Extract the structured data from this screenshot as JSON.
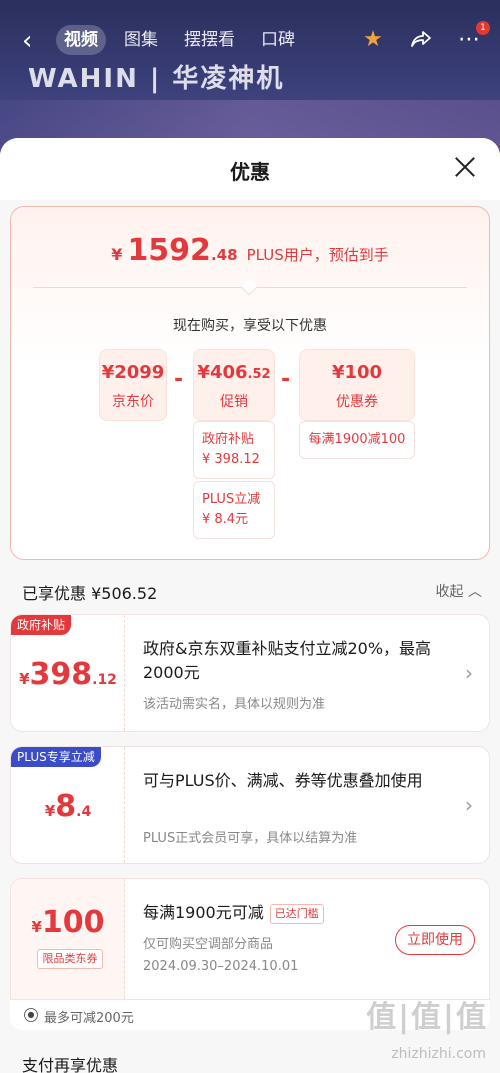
{
  "topbar": {
    "tabs": [
      "视频",
      "图集",
      "摆摆看",
      "口碑"
    ],
    "badge": "1"
  },
  "brand": "WAHIN | 华凌神机",
  "sheet": {
    "title": "优惠"
  },
  "summary": {
    "currency": "¥",
    "price_int": "1592",
    "price_dec": ".48",
    "price_note": "PLUS用户，预估到手",
    "now_text": "现在购买，享受以下优惠",
    "jd_price": {
      "amount": "¥2099",
      "label": "京东价"
    },
    "promo": {
      "amount": "¥406",
      "dec": ".52",
      "label": "促销"
    },
    "coupon": {
      "amount": "¥100",
      "label": "优惠券",
      "detail": "每满1900减100"
    },
    "promo_items": [
      {
        "name": "政府补贴",
        "value": "¥ 398.12"
      },
      {
        "name": "PLUS立减",
        "value": "¥ 8.4元"
      }
    ]
  },
  "enjoyed": {
    "label": "已享优惠 ¥506.52",
    "collapse": "收起"
  },
  "cards": [
    {
      "tag": "政府补贴",
      "currency": "¥",
      "amount": "398",
      "dec": ".12",
      "title": "政府&京东双重补贴支付立减20%，最高2000元",
      "sub": "该活动需实名，具体以规则为准"
    },
    {
      "tag": "PLUS专享立减",
      "currency": "¥",
      "amount": "8",
      "dec": ".4",
      "title": "可与PLUS价、满减、券等优惠叠加使用",
      "sub": "PLUS正式会员可享，具体以结算为准"
    }
  ],
  "coupon_card": {
    "currency": "¥",
    "amount": "100",
    "type_label": "限品类东券",
    "title": "每满1900元可减",
    "reached": "已达门槛",
    "desc": "仅可购买空调部分商品",
    "date": "2024.09.30–2024.10.01",
    "button": "立即使用"
  },
  "max_line": "最多可减200元",
  "pay_more": "支付再享优惠",
  "watermark": "值|值|值",
  "watermark_site": "zhizhizhi.com",
  "colors": {
    "accent": "#e4393c",
    "plus_blue": "#3a4cc8"
  }
}
